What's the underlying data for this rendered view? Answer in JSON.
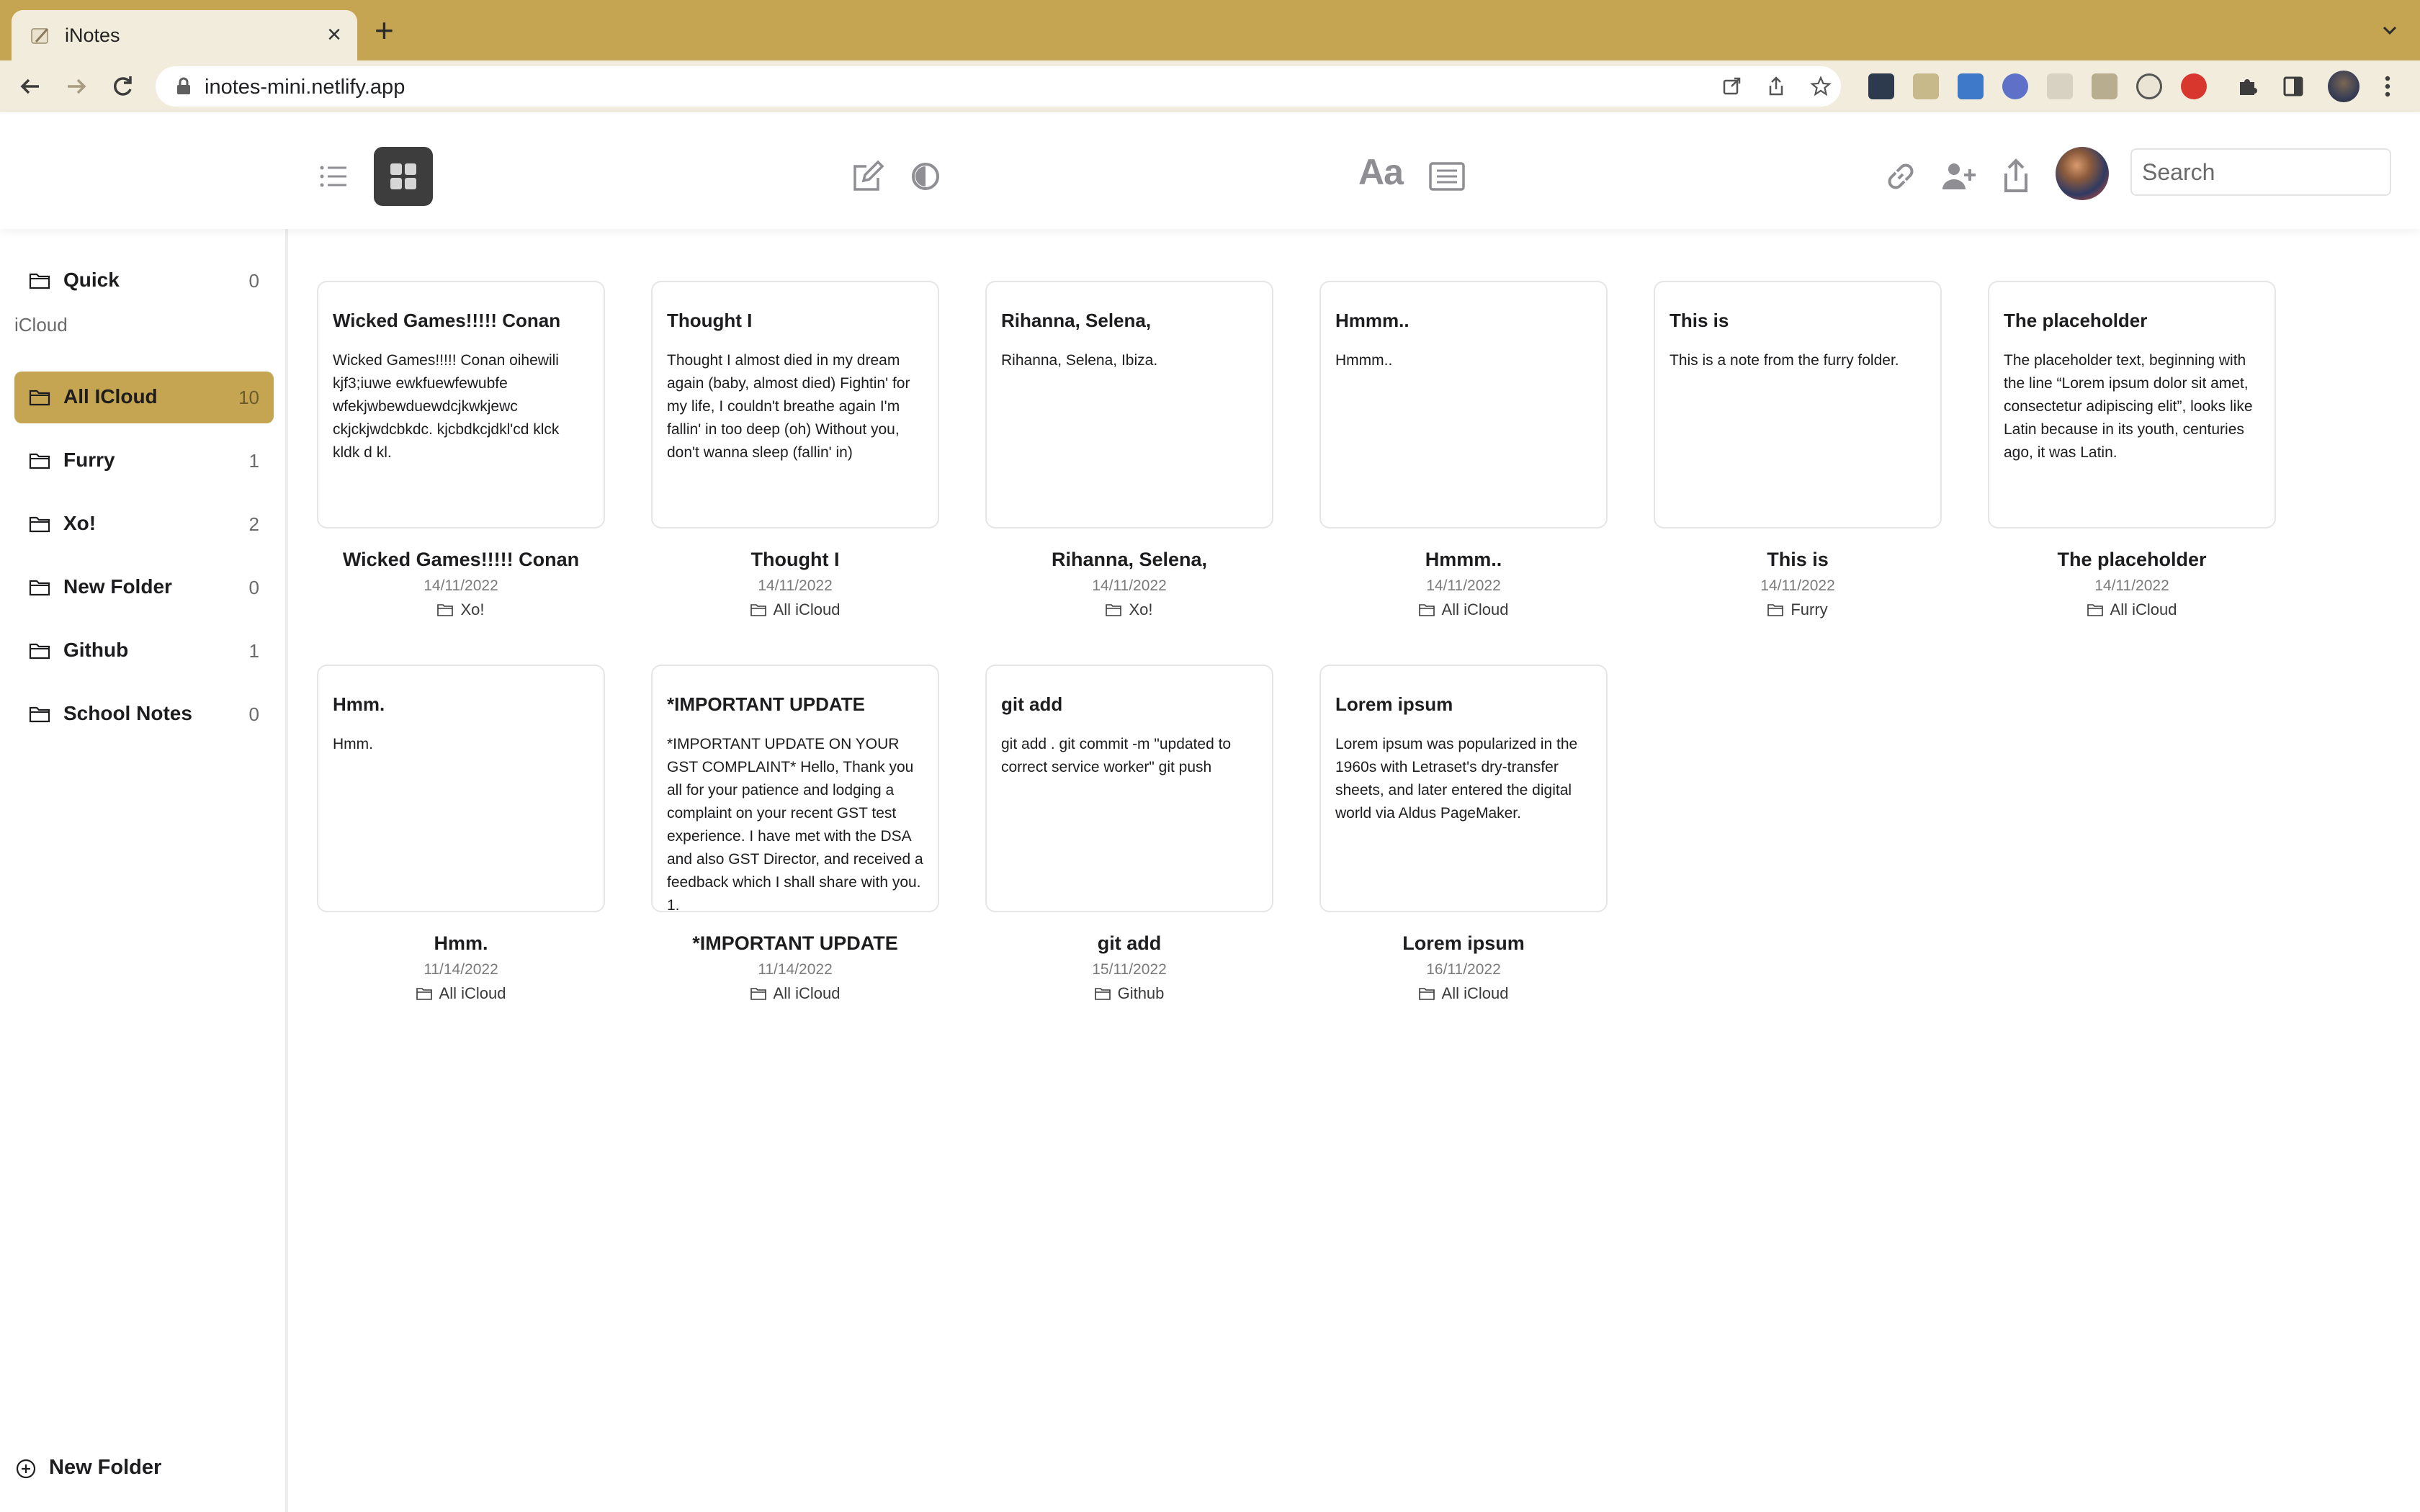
{
  "browser": {
    "tab_title": "iNotes",
    "url": "inotes-mini.netlify.app"
  },
  "header": {
    "search_placeholder": "Search",
    "font_button": "Aa"
  },
  "sidebar": {
    "quick": {
      "name": "Quick",
      "count": "0"
    },
    "section_label": "iCloud",
    "folders": [
      {
        "name": "All ICloud",
        "count": "10"
      },
      {
        "name": "Furry",
        "count": "1"
      },
      {
        "name": "Xo!",
        "count": "2"
      },
      {
        "name": "New Folder",
        "count": "0"
      },
      {
        "name": "Github",
        "count": "1"
      },
      {
        "name": "School Notes",
        "count": "0"
      }
    ],
    "new_folder_label": "New Folder"
  },
  "notes": [
    {
      "card_title": "Wicked Games!!!!! Conan",
      "body": "Wicked Games!!!!! Conan oihewili kjf3;iuwe ewkfuewfewubfe wfekjwbewduewdcjkwkjewc ckjckjwdcbkdc. kjcbdkcjdkl'cd klck kldk d kl.",
      "title": "Wicked Games!!!!! Conan",
      "date": "14/11/2022",
      "folder": "Xo!"
    },
    {
      "card_title": "Thought I",
      "body": "Thought I almost died in my dream again (baby, almost died) Fightin' for my life, I couldn't breathe again I'm fallin' in too deep (oh) Without you, don't wanna sleep (fallin' in)",
      "title": "Thought I",
      "date": "14/11/2022",
      "folder": "All iCloud"
    },
    {
      "card_title": "Rihanna, Selena,",
      "body": "Rihanna, Selena, Ibiza.",
      "title": "Rihanna, Selena,",
      "date": "14/11/2022",
      "folder": "Xo!"
    },
    {
      "card_title": "Hmmm..",
      "body": "Hmmm..",
      "title": "Hmmm..",
      "date": "14/11/2022",
      "folder": "All iCloud"
    },
    {
      "card_title": "This is",
      "body": "This is a note from the furry folder.",
      "title": "This is",
      "date": "14/11/2022",
      "folder": "Furry"
    },
    {
      "card_title": "The placeholder",
      "body": "The placeholder text, beginning with the line “Lorem ipsum dolor sit amet, consectetur adipiscing elit”, looks like Latin because in its youth, centuries ago, it was Latin.",
      "title": "The placeholder",
      "date": "14/11/2022",
      "folder": "All iCloud"
    },
    {
      "card_title": "Hmm.",
      "body": "Hmm.",
      "title": "Hmm.",
      "date": "11/14/2022",
      "folder": "All iCloud"
    },
    {
      "card_title": "*IMPORTANT UPDATE",
      "body": "*IMPORTANT UPDATE ON YOUR GST COMPLAINT* Hello, Thank you all for your patience and lodging a complaint on your recent GST test experience. I have met with the DSA and also GST Director, and received a feedback which I shall share with you. 1.",
      "title": "*IMPORTANT UPDATE",
      "date": "11/14/2022",
      "folder": "All iCloud"
    },
    {
      "card_title": "git add",
      "body": "git add . git commit -m \"updated to correct service worker\" git push",
      "title": "git add",
      "date": "15/11/2022",
      "folder": "Github"
    },
    {
      "card_title": "Lorem ipsum",
      "body": "Lorem ipsum was popularized in the 1960s with Letraset's dry-transfer sheets, and later entered the digital world via Aldus PageMaker.",
      "title": "Lorem ipsum",
      "date": "16/11/2022",
      "folder": "All iCloud"
    }
  ]
}
